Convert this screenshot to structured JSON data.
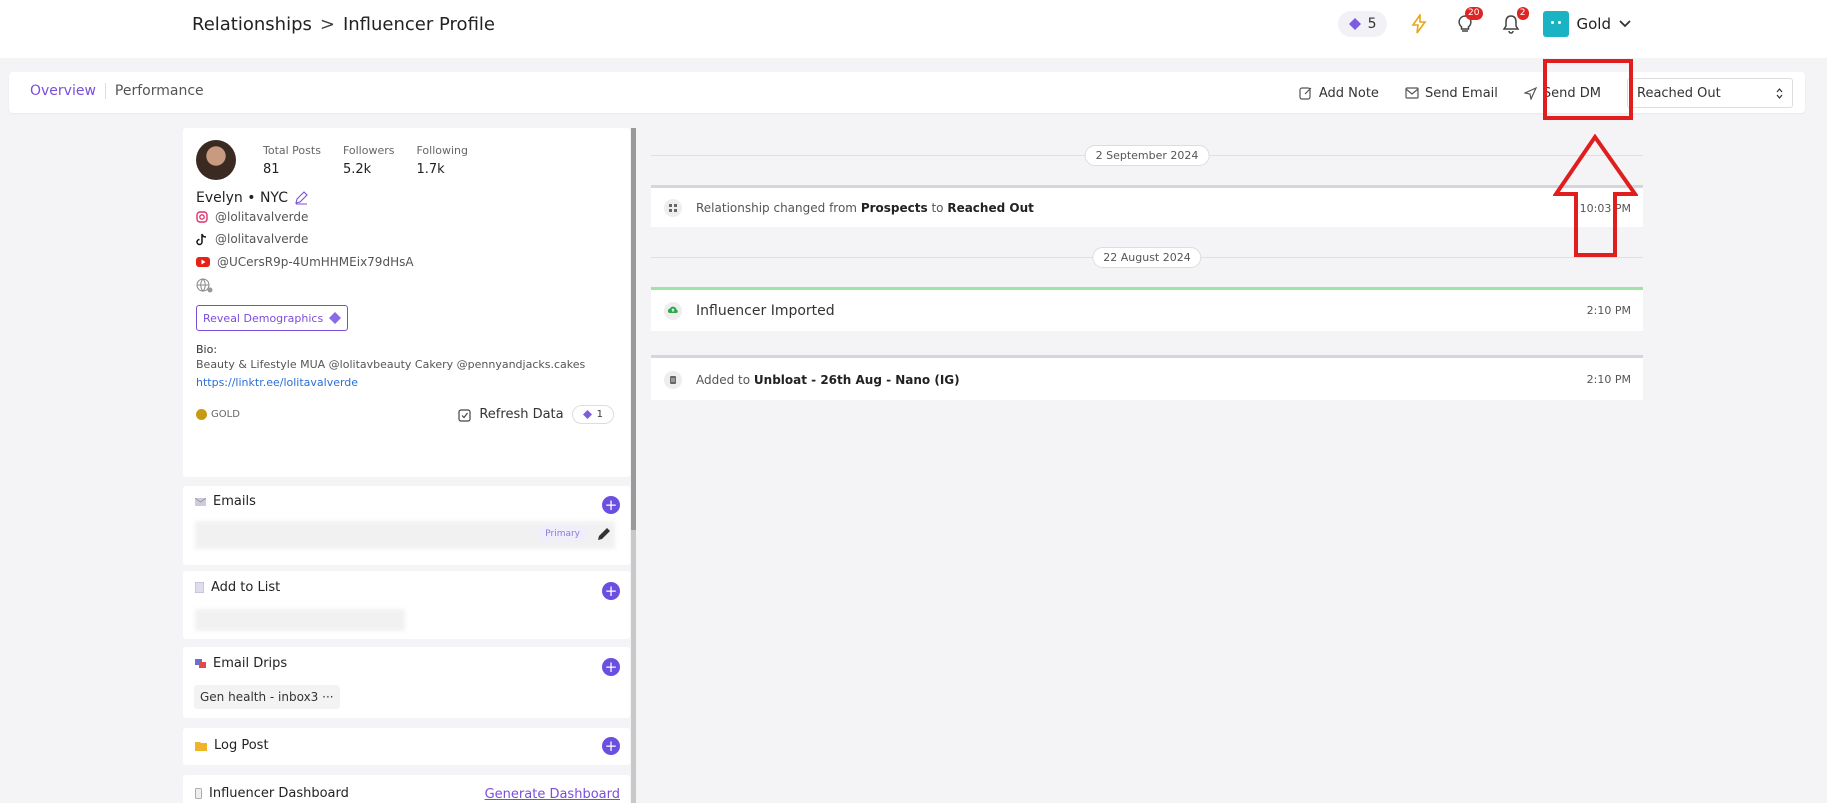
{
  "header": {
    "breadcrumb_root": "Relationships",
    "breadcrumb_sep": ">",
    "breadcrumb_current": "Influencer Profile",
    "credits": "5",
    "ideas_badge": "20",
    "notif_badge": "2",
    "account_name": "Gold"
  },
  "subnav": {
    "tabs": [
      {
        "label": "Overview"
      },
      {
        "label": "Performance"
      }
    ],
    "add_note": "Add Note",
    "send_email": "Send Email",
    "send_dm": "Send DM",
    "status_select": "Reached Out"
  },
  "profile": {
    "stats": [
      {
        "label": "Total Posts",
        "value": "81"
      },
      {
        "label": "Followers",
        "value": "5.2k"
      },
      {
        "label": "Following",
        "value": "1.7k"
      }
    ],
    "name": "Evelyn • NYC",
    "instagram": "@lolitavalverde",
    "tiktok": "@lolitavalverde",
    "youtube": "@UCersR9p-4UmHHMEix79dHsA",
    "reveal_label": "Reveal Demographics",
    "bio_label": "Bio:",
    "bio_text": "Beauty & Lifestyle MUA @lolitavbeauty Cakery @pennyandjacks.cakes",
    "bio_link": "https://linktr.ee/lolitavalverde",
    "tier": "GOLD",
    "refresh_label": "Refresh Data",
    "refresh_cost": "1"
  },
  "sections": {
    "emails": {
      "title": "Emails",
      "primary": "Primary"
    },
    "add_to_list": {
      "title": "Add to List"
    },
    "email_drips": {
      "title": "Email Drips",
      "chip": "Gen health - inbox3",
      "chip_more": "···"
    },
    "log_post": {
      "title": "Log Post"
    },
    "dashboard": {
      "title": "Influencer Dashboard",
      "link": "Generate Dashboard"
    }
  },
  "timeline": {
    "date1": "2 September 2024",
    "event1": {
      "prefix": "Relationship changed from ",
      "from": "Prospects",
      "mid": " to ",
      "to": "Reached Out",
      "time": "10:03 PM"
    },
    "date2": "22 August 2024",
    "event2": {
      "text": "Influencer Imported",
      "time": "2:10 PM"
    },
    "event3": {
      "prefix": "Added to ",
      "list": "Unbloat - 26th Aug - Nano (IG)",
      "time": "2:10 PM"
    }
  },
  "colors": {
    "accent": "#7c4ddb",
    "plus": "#6a4fe0",
    "highlight": "#e01e1e",
    "imported": "#4cc96a"
  }
}
